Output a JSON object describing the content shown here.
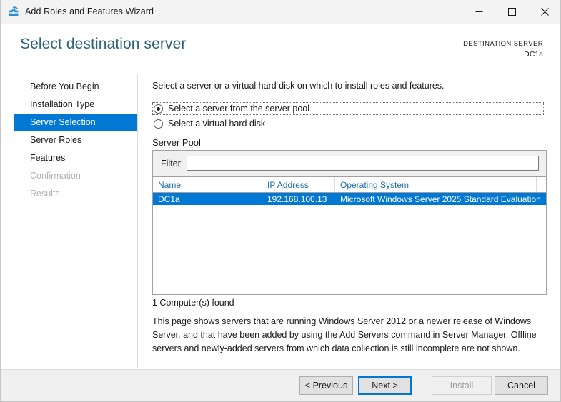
{
  "window": {
    "title": "Add Roles and Features Wizard",
    "icon": "wizard-toolbox-icon",
    "controls": {
      "minimize": "minimize-icon",
      "maximize": "maximize-icon",
      "close": "close-icon"
    }
  },
  "header": {
    "page_title": "Select destination server",
    "destination_label": "DESTINATION SERVER",
    "destination_value": "DC1a",
    "accent_color": "#2f6478"
  },
  "sidebar": {
    "selection_color": "#0078d4",
    "items": [
      {
        "label": "Before You Begin",
        "state": "enabled"
      },
      {
        "label": "Installation Type",
        "state": "enabled"
      },
      {
        "label": "Server Selection",
        "state": "selected"
      },
      {
        "label": "Server Roles",
        "state": "enabled"
      },
      {
        "label": "Features",
        "state": "enabled"
      },
      {
        "label": "Confirmation",
        "state": "disabled"
      },
      {
        "label": "Results",
        "state": "disabled"
      }
    ]
  },
  "main": {
    "intro": "Select a server or a virtual hard disk on which to install roles and features.",
    "radios": [
      {
        "label": "Select a server from the server pool",
        "checked": true,
        "focused": true
      },
      {
        "label": "Select a virtual hard disk",
        "checked": false,
        "focused": false
      }
    ],
    "server_pool": {
      "group_label": "Server Pool",
      "filter_label": "Filter:",
      "filter_value": "",
      "filter_placeholder": "",
      "columns": [
        "Name",
        "IP Address",
        "Operating System",
        ""
      ],
      "rows": [
        {
          "name": "DC1a",
          "ip_address": "192.168.100.13",
          "operating_system": "Microsoft Windows Server 2025 Standard Evaluation",
          "selected": true
        }
      ],
      "found_text": "1 Computer(s) found"
    },
    "help_text": "This page shows servers that are running Windows Server 2012 or a newer release of Windows Server, and that have been added by using the Add Servers command in Server Manager. Offline servers and newly-added servers from which data collection is still incomplete are not shown."
  },
  "footer": {
    "buttons": [
      {
        "label": "< Previous",
        "state": "enabled"
      },
      {
        "label": "Next >",
        "state": "default"
      },
      {
        "label": "Install",
        "state": "disabled"
      },
      {
        "label": "Cancel",
        "state": "enabled"
      }
    ]
  }
}
